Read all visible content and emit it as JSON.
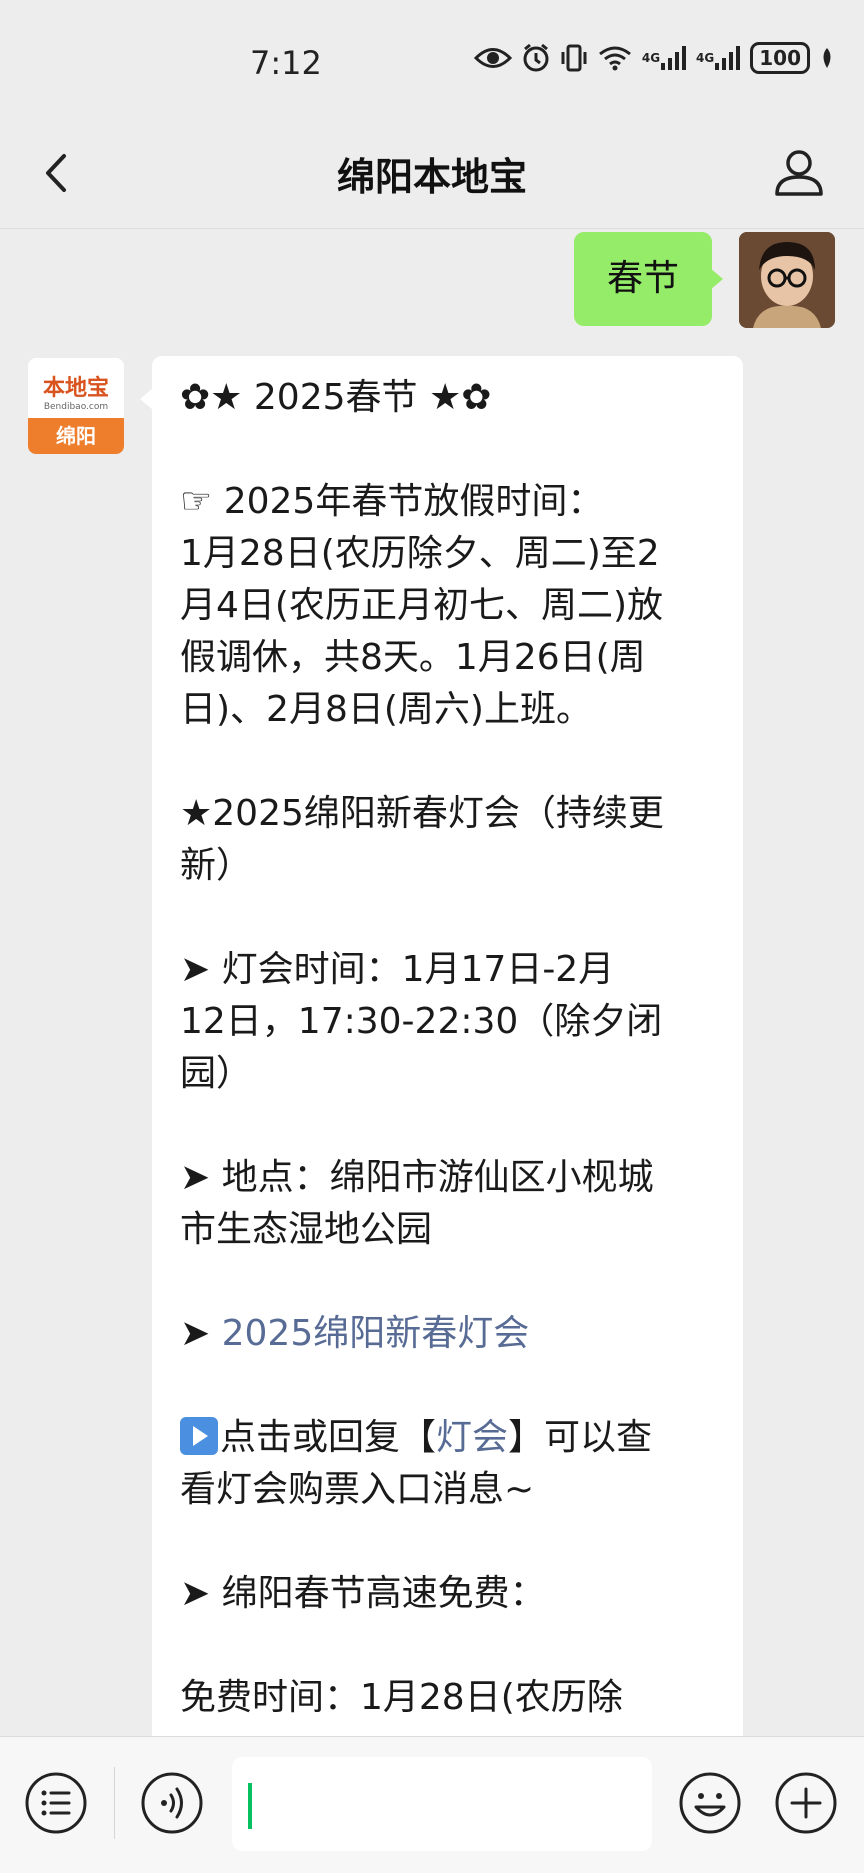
{
  "status_bar": {
    "time": "7:12",
    "signal1": "4G",
    "signal2": "4G",
    "battery": "100"
  },
  "nav": {
    "title": "绵阳本地宝"
  },
  "outgoing": {
    "text": "春节"
  },
  "bot_avatar": {
    "logo_text": "本地宝",
    "logo_url": "Bendibao.com",
    "logo_city": "绵阳"
  },
  "message": {
    "title": "✿★ 2025春节 ★✿",
    "holiday_label": "☞ 2025年春节放假时间：",
    "holiday_1": "1月28日(农历除夕、周二)至2",
    "holiday_2": "月4日(农历正月初七、周二)放",
    "holiday_3": "假调休，共8天。1月26日(周",
    "holiday_4": "日)、2月8日(周六)上班。",
    "lantern_1": "★2025绵阳新春灯会（持续更",
    "lantern_2": "新）",
    "time_1": "➤ 灯会时间：1月17日-2月",
    "time_2": "12日，17:30-22:30（除夕闭",
    "time_3": "园）",
    "place_1": "➤ 地点：绵阳市游仙区小枧城",
    "place_2": "市生态湿地公园",
    "link_arrow": "➤ ",
    "link_text": "2025绵阳新春灯会",
    "reply_pre": "点击或回复【",
    "reply_link": "灯会",
    "reply_post": "】可以查",
    "reply_2": "看灯会购票入口消息~",
    "highway": "➤ 绵阳春节高速免费：",
    "free_time": "免费时间：1月28日(农历除"
  },
  "colors": {
    "background": "#ededed",
    "outgoing_bubble": "#95ec69",
    "link": "#576b95",
    "brand_orange": "#ee7d2c",
    "cursor": "#07c160"
  },
  "icons": [
    "back-arrow-icon",
    "profile-icon",
    "menu-icon",
    "voice-icon",
    "emoji-icon",
    "plus-icon",
    "play-icon"
  ]
}
